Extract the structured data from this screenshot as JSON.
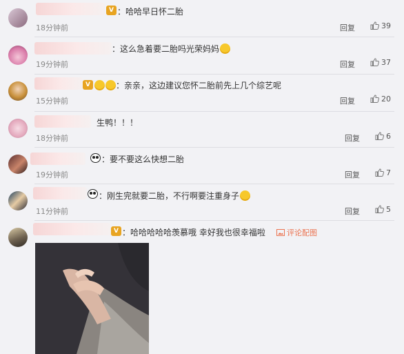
{
  "comments": [
    {
      "text": "：哈哈早日怀二胎",
      "time": "18分钟前",
      "reply": "回复",
      "likes": "39"
    },
    {
      "text": "：这么急着要二胎吗光荣妈妈",
      "time": "19分钟前",
      "reply": "回复",
      "likes": "37"
    },
    {
      "text": "：亲亲，这边建议您怀二胎前先上几个综艺呢",
      "time": "15分钟前",
      "reply": "回复",
      "likes": "20"
    },
    {
      "text": "生鸭！！！",
      "time": "18分钟前",
      "reply": "回复",
      "likes": "6"
    },
    {
      "text": "：要不要这么快想二胎",
      "time": "19分钟前",
      "reply": "回复",
      "likes": "7"
    },
    {
      "text": "：刚生完就要二胎，不行啊要注重身子",
      "time": "11分钟前",
      "reply": "回复",
      "likes": "5"
    },
    {
      "text": "：哈哈哈哈哈羡慕哦  幸好我也很幸福啦",
      "image_link": "评论配图"
    }
  ],
  "icons": {
    "like": "thumbs-up-icon",
    "image": "image-icon",
    "badge": "vip-badge-icon",
    "panda": "panda-emoji-icon",
    "emoji": "smiley-emoji-icon"
  },
  "colors": {
    "background": "#f2f2f5",
    "link": "#eb7350",
    "meta": "#888888"
  }
}
